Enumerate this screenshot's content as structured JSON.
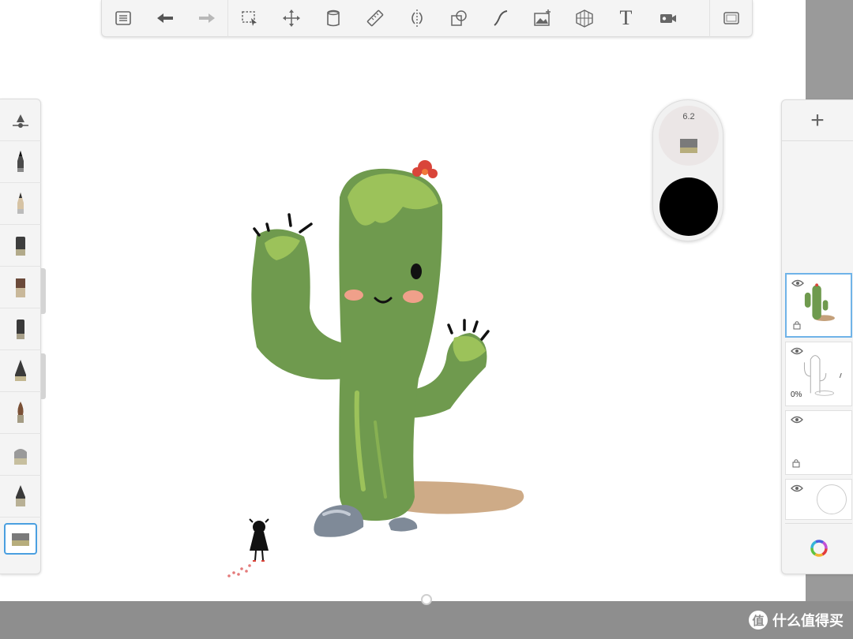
{
  "toolbar": {
    "tools": [
      {
        "name": "menu-icon"
      },
      {
        "name": "undo-icon"
      },
      {
        "name": "redo-icon"
      },
      {
        "name": "selection-icon"
      },
      {
        "name": "transform-icon"
      },
      {
        "name": "fill-bucket-icon"
      },
      {
        "name": "ruler-icon"
      },
      {
        "name": "symmetry-icon"
      },
      {
        "name": "shapes-icon"
      },
      {
        "name": "curve-icon"
      },
      {
        "name": "add-image-icon"
      },
      {
        "name": "perspective-grid-icon"
      },
      {
        "name": "text-icon"
      },
      {
        "name": "record-icon"
      },
      {
        "name": "fullscreen-icon"
      }
    ],
    "text_tool_glyph": "T"
  },
  "brush_palette": {
    "items": [
      "brush-settings-icon",
      "pencil-icon",
      "soft-pencil-icon",
      "marker-icon",
      "paint-brush-icon",
      "ink-pen-icon",
      "airbrush-icon",
      "watercolor-icon",
      "eraser-icon",
      "smudge-icon",
      "hard-eraser-icon"
    ],
    "selected_index": 10
  },
  "puck": {
    "size_value": "6.2",
    "current_color": "#000000"
  },
  "layers": {
    "add_label": "+",
    "items": [
      {
        "name": "layer-cactus",
        "active": true
      },
      {
        "name": "layer-sketch",
        "opacity_label": "0%"
      },
      {
        "name": "layer-empty",
        "locked": true
      },
      {
        "name": "layer-background"
      }
    ]
  },
  "watermark": {
    "badge": "值",
    "text": "什么值得买"
  },
  "colors": {
    "accent": "#4a9fe0",
    "cactus": "#6f9a4e",
    "cactus_highlight": "#9cc25a",
    "flower": "#d9453a"
  }
}
